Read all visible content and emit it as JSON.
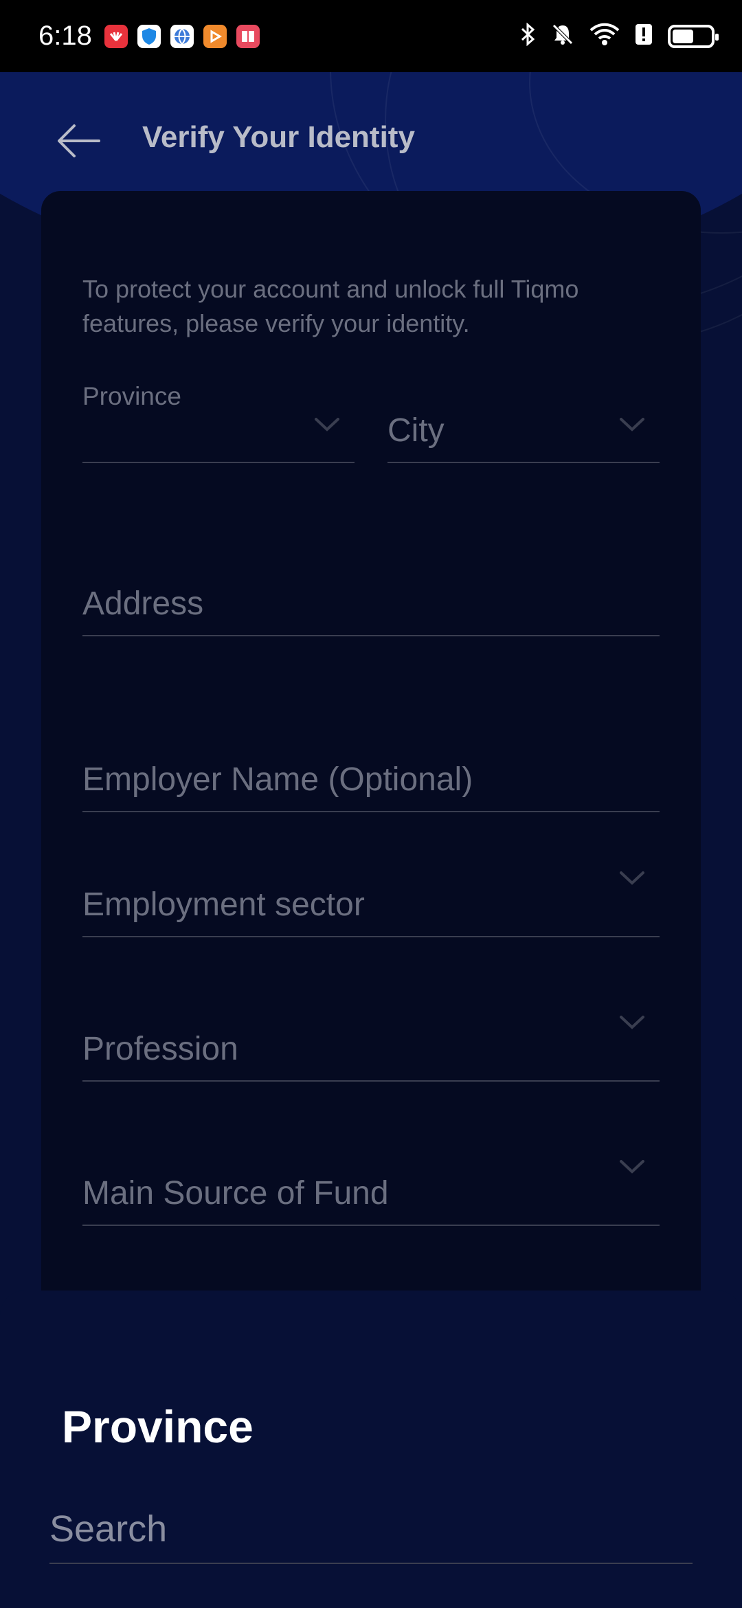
{
  "status_bar": {
    "time": "6:18",
    "app_icons": [
      {
        "name": "huawei-app-icon",
        "color": "#e8323c"
      },
      {
        "name": "shield-app-icon",
        "color": "#1e88e5"
      },
      {
        "name": "globe-app-icon",
        "color": "#3d7bd9"
      },
      {
        "name": "video-app-icon",
        "color": "#f08a2c"
      },
      {
        "name": "book-app-icon",
        "color": "#e84a5f"
      }
    ],
    "battery_level": 0.55
  },
  "header": {
    "title": "Verify Your Identity"
  },
  "form": {
    "intro": "To protect your account and unlock full Tiqmo features, please verify your identity.",
    "province_label": "Province",
    "city_placeholder": "City",
    "address_placeholder": "Address",
    "employer_placeholder": "Employer Name (Optional)",
    "sector_placeholder": "Employment sector",
    "profession_placeholder": "Profession",
    "fund_placeholder": "Main Source of Fund"
  },
  "sheet": {
    "title": "Province",
    "search_placeholder": "Search"
  },
  "colors": {
    "header_bg": "#0b1b5c",
    "card_bg": "#050a21",
    "sheet_bg": "#071036",
    "muted_text": "#6b6f80"
  }
}
